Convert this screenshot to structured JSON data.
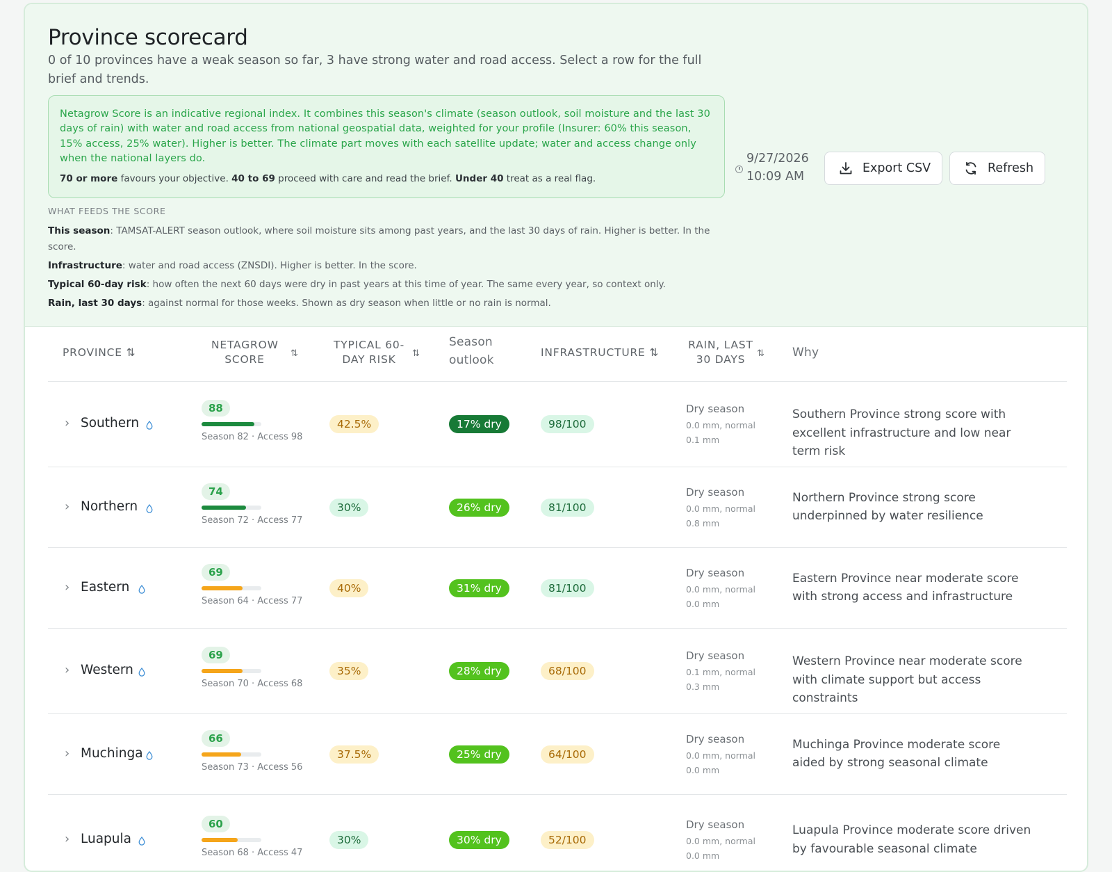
{
  "header": {
    "title": "Province scorecard",
    "subtitle": "0 of 10 provinces have a weak season so far, 3 have strong water and road access. Select a row for the full brief and trends.",
    "info": {
      "text": "Netagrow Score is an indicative regional index. It combines this season's climate (season outlook, soil moisture and the last 30 days of rain) with water and road access from national geospatial data, weighted for your profile (Insurer: 60% this season, 15% access, 25% water). Higher is better. The climate part moves with each satellite update; water and access change only when the national layers do.",
      "t1_bold": "70 or more",
      "t1": " favours your objective. ",
      "t2_bold": "40 to 69",
      "t2": " proceed with care and read the brief. ",
      "t3_bold": "Under 40",
      "t3": " treat as a real flag."
    },
    "feeds": {
      "title": "WHAT FEEDS THE SCORE",
      "items": [
        {
          "label": "This season",
          "text": ": TAMSAT-ALERT season outlook, where soil moisture sits among past years, and the last 30 days of rain. Higher is better. In the score."
        },
        {
          "label": "Infrastructure",
          "text": ": water and road access (ZNSDI). Higher is better. In the score."
        },
        {
          "label": "Typical 60-day risk",
          "text": ": how often the next 60 days were dry in past years at this time of year. The same every year, so context only."
        },
        {
          "label": "Rain, last 30 days",
          "text": ": against normal for those weeks. Shown as dry season when little or no rain is normal."
        }
      ]
    },
    "timestamp": {
      "date": "9/27/2026",
      "time": "10:09 AM"
    },
    "export_label": "Export CSV",
    "refresh_label": "Refresh"
  },
  "table": {
    "columns": {
      "province": "PROVINCE",
      "score_l1": "NETAGROW",
      "score_l2": "SCORE",
      "risk_l1": "TYPICAL 60-",
      "risk_l2": "DAY RISK",
      "outlook_l1": "Season",
      "outlook_l2": "outlook",
      "infra": "INFRASTRUCTURE",
      "rain_l1": "RAIN, LAST",
      "rain_l2": "30 DAYS",
      "why": "Why"
    },
    "rows": [
      {
        "name": "Southern",
        "score": "88",
        "score_value": 88,
        "sub": "Season 82 · Access 98",
        "risk": "42.5%",
        "risk_tone": "amber",
        "outlook": "17% dry",
        "outlook_tone": "dark",
        "infra": "98/100",
        "infra_tone": "green",
        "rain_title": "Dry season",
        "rain_l1": "0.0 mm, normal",
        "rain_l2": "0.1 mm",
        "why": "Southern Province strong score with excellent infrastructure and low near term risk"
      },
      {
        "name": "Northern",
        "score": "74",
        "score_value": 74,
        "sub": "Season 72 · Access 77",
        "risk": "30%",
        "risk_tone": "green",
        "outlook": "26% dry",
        "outlook_tone": "light",
        "infra": "81/100",
        "infra_tone": "green",
        "rain_title": "Dry season",
        "rain_l1": "0.0 mm, normal",
        "rain_l2": "0.8 mm",
        "why": "Northern Province strong score underpinned by water resilience"
      },
      {
        "name": "Eastern",
        "score": "69",
        "score_value": 69,
        "sub": "Season 64 · Access 77",
        "risk": "40%",
        "risk_tone": "amber",
        "outlook": "31% dry",
        "outlook_tone": "light",
        "infra": "81/100",
        "infra_tone": "green",
        "rain_title": "Dry season",
        "rain_l1": "0.0 mm, normal",
        "rain_l2": "0.0 mm",
        "why": "Eastern Province near moderate score with strong access and infrastructure"
      },
      {
        "name": "Western",
        "score": "69",
        "score_value": 69,
        "sub": "Season 70 · Access 68",
        "risk": "35%",
        "risk_tone": "amber",
        "outlook": "28% dry",
        "outlook_tone": "light",
        "infra": "68/100",
        "infra_tone": "amber",
        "rain_title": "Dry season",
        "rain_l1": "0.1 mm, normal",
        "rain_l2": "0.3 mm",
        "why": "Western Province near moderate score with climate support but access constraints"
      },
      {
        "name": "Muchinga",
        "score": "66",
        "score_value": 66,
        "sub": "Season 73 · Access 56",
        "risk": "37.5%",
        "risk_tone": "amber",
        "outlook": "25% dry",
        "outlook_tone": "light",
        "infra": "64/100",
        "infra_tone": "amber",
        "rain_title": "Dry season",
        "rain_l1": "0.0 mm, normal",
        "rain_l2": "0.0 mm",
        "why": "Muchinga Province moderate score aided by strong seasonal climate"
      },
      {
        "name": "Luapula",
        "score": "60",
        "score_value": 60,
        "sub": "Season 68 · Access 47",
        "risk": "30%",
        "risk_tone": "green",
        "outlook": "30% dry",
        "outlook_tone": "light",
        "infra": "52/100",
        "infra_tone": "amber",
        "rain_title": "Dry season",
        "rain_l1": "0.0 mm, normal",
        "rain_l2": "0.0 mm",
        "why": "Luapula Province moderate score driven by favourable seasonal climate"
      }
    ]
  },
  "colors": {
    "bar_strong": "#1c8a3e",
    "bar_moderate": "#f5a51a",
    "accent": "#2ba24b"
  }
}
